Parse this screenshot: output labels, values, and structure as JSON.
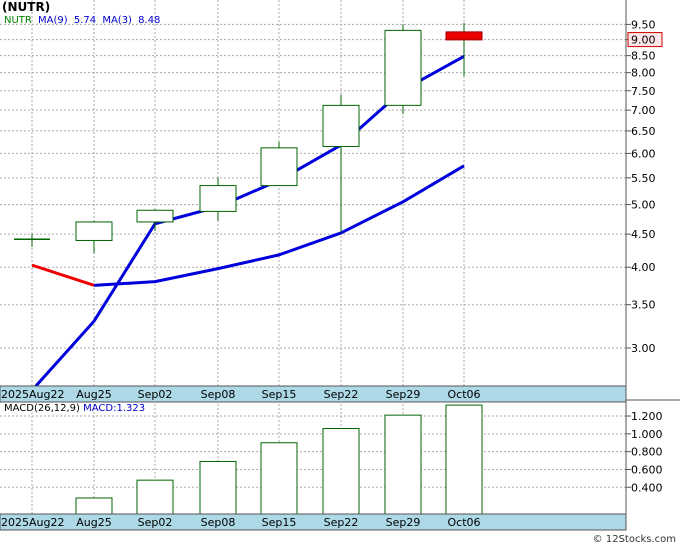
{
  "title": "(NUTR)",
  "legend": {
    "symbol": "NUTR",
    "ma_slow": "MA(9)",
    "ma_slow_value": "5.74",
    "ma_fast": "MA(3)",
    "ma_fast_value": "8.48"
  },
  "macd_legend": {
    "label": "MACD(26,12,9)",
    "value": "MACD:1.323"
  },
  "watermark": "© 12Stocks.com",
  "colors": {
    "up_candle": "#ffffff",
    "candle_border": "#006400",
    "ma_line": "#0000dd",
    "ma_negative": "#ee0000",
    "last_price_box": "#ee0000",
    "axis_band": "#add8e6",
    "grid": "#aaaaaa",
    "symbol_text": "#008000",
    "legend_text": "#0000cc"
  },
  "chart_data": [
    {
      "type": "candlestick",
      "panel": "price",
      "categories": [
        "2025Aug22",
        "Aug25",
        "Sep02",
        "Sep08",
        "Sep15",
        "Sep22",
        "Sep29",
        "Oct06"
      ],
      "ohlc": [
        {
          "open": 4.42,
          "high": 4.5,
          "low": 4.3,
          "close": 4.42
        },
        {
          "open": 4.4,
          "high": 4.72,
          "low": 4.2,
          "close": 4.7
        },
        {
          "open": 4.7,
          "high": 4.92,
          "low": 4.55,
          "close": 4.9
        },
        {
          "open": 4.88,
          "high": 5.5,
          "low": 4.72,
          "close": 5.35
        },
        {
          "open": 5.35,
          "high": 6.25,
          "low": 5.35,
          "close": 6.12
        },
        {
          "open": 6.15,
          "high": 7.4,
          "low": 4.52,
          "close": 7.12
        },
        {
          "open": 7.12,
          "high": 9.5,
          "low": 6.9,
          "close": 9.3
        },
        {
          "open": 9.25,
          "high": 9.55,
          "low": 7.9,
          "close": 9.0
        }
      ],
      "last_price": "9.00",
      "series": [
        {
          "name": "MA(3)",
          "values": [
            2.58,
            3.3,
            4.67,
            4.96,
            5.45,
            6.18,
            7.52,
            8.48
          ]
        },
        {
          "name": "MA(9)",
          "values": [
            4.03,
            3.75,
            3.8,
            3.98,
            4.18,
            4.52,
            5.05,
            5.74
          ]
        }
      ],
      "ma9_negative_segment": [
        0,
        1
      ],
      "y_ticks": [
        "3.00",
        "3.50",
        "4.00",
        "4.50",
        "5.00",
        "5.50",
        "6.00",
        "6.50",
        "7.00",
        "7.50",
        "8.00",
        "8.50",
        "9.00",
        "9.50"
      ],
      "y_scale": "log",
      "ylim": [
        2.62,
        10.0
      ],
      "grid": true
    },
    {
      "type": "bar",
      "panel": "macd",
      "categories": [
        "2025Aug22",
        "Aug25",
        "Sep02",
        "Sep08",
        "Sep15",
        "Sep22",
        "Sep29",
        "Oct06"
      ],
      "values": [
        0.0,
        0.28,
        0.48,
        0.69,
        0.9,
        1.06,
        1.21,
        1.323
      ],
      "y_ticks": [
        "0.400",
        "0.600",
        "0.800",
        "1.000",
        "1.200"
      ],
      "ylim": [
        0.1,
        1.38
      ],
      "grid": true
    }
  ]
}
